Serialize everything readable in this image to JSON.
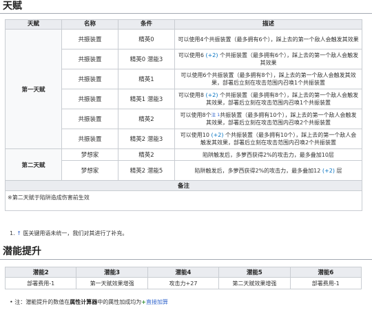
{
  "talent_title": "天赋",
  "talent_headers": [
    "天赋",
    "名称",
    "条件",
    "描述"
  ],
  "talent_groups": [
    {
      "category": "第一天赋",
      "rows": [
        {
          "name": "共振装置",
          "condition": "精英0",
          "desc": [
            "可以使用4个共振装置（最多拥有6个），踩上去的第一个敌人会触发其效果"
          ]
        },
        {
          "name": "共振装置",
          "condition": "精英0 潜能3",
          "desc": [
            "可以使用6 ",
            "(+2)",
            " 个共振装置（最多拥有6个），踩上去的第一个敌人会触发其效果"
          ]
        },
        {
          "name": "共振装置",
          "condition": "精英1",
          "desc": [
            "可以使用6个共振装置（最多拥有8个），踩上去的第一个敌人会触发其效果，部署后立刻在攻击范围内召唤1个共振装置"
          ]
        },
        {
          "name": "共振装置",
          "condition": "精英1 潜能3",
          "desc": [
            "可以使用8 ",
            "(+2)",
            " 个共振装置（最多拥有8个），踩上去的第一个敌人会触发其效果，部署后立刻在攻击范围内召唤1个共振装置"
          ]
        },
        {
          "name": "共振装置",
          "condition": "精英2",
          "desc": [
            "可以使用8个",
            "注 1",
            "共振装置（最多拥有10个），踩上去的第一个敌人会触发其效果，部署后立刻在攻击范围内召唤2个共振装置"
          ]
        },
        {
          "name": "共振装置",
          "condition": "精英2 潜能3",
          "desc": [
            "可以使用10 ",
            "(+2)",
            " 个共振装置（最多拥有10个），踩上去的第一个敌人会触发其效果，部署后立刻在攻击范围内召唤2个共振装置"
          ]
        }
      ]
    },
    {
      "category": "第二天赋",
      "rows": [
        {
          "name": "梦想家",
          "condition": "精英2",
          "desc": [
            "陷阱触发后，多萝西获得2%的攻击力，最多叠加10层"
          ]
        },
        {
          "name": "梦想家",
          "condition": "精英2 潜能5",
          "desc": [
            "陷阱触发后，多萝西获得2%的攻击力，最多叠加12 ",
            "(+2)",
            " 层"
          ]
        }
      ]
    }
  ],
  "note_header": "备注",
  "note_text": "※第二天赋于陷阱造成伤害前生效",
  "footnote": {
    "marker": "1.",
    "arrow": "↑",
    "text": "医关键用语未统一，我们对其进行了补充。"
  },
  "potential_title": "潜能提升",
  "potential_headers": [
    "潜能2",
    "潜能3",
    "潜能4",
    "潜能5",
    "潜能6"
  ],
  "potential_values": [
    "部署费用-1",
    "第一天赋效果增强",
    "攻击力+27",
    "第二天赋效果增强",
    "部署费用-1"
  ],
  "bottom_note": {
    "bullet": "•",
    "prefix": "注：潜能提升的数值在",
    "bold": "属性计算器",
    "middle": "中的属性加成均为",
    "plus": "+",
    "link": "直接加算"
  }
}
